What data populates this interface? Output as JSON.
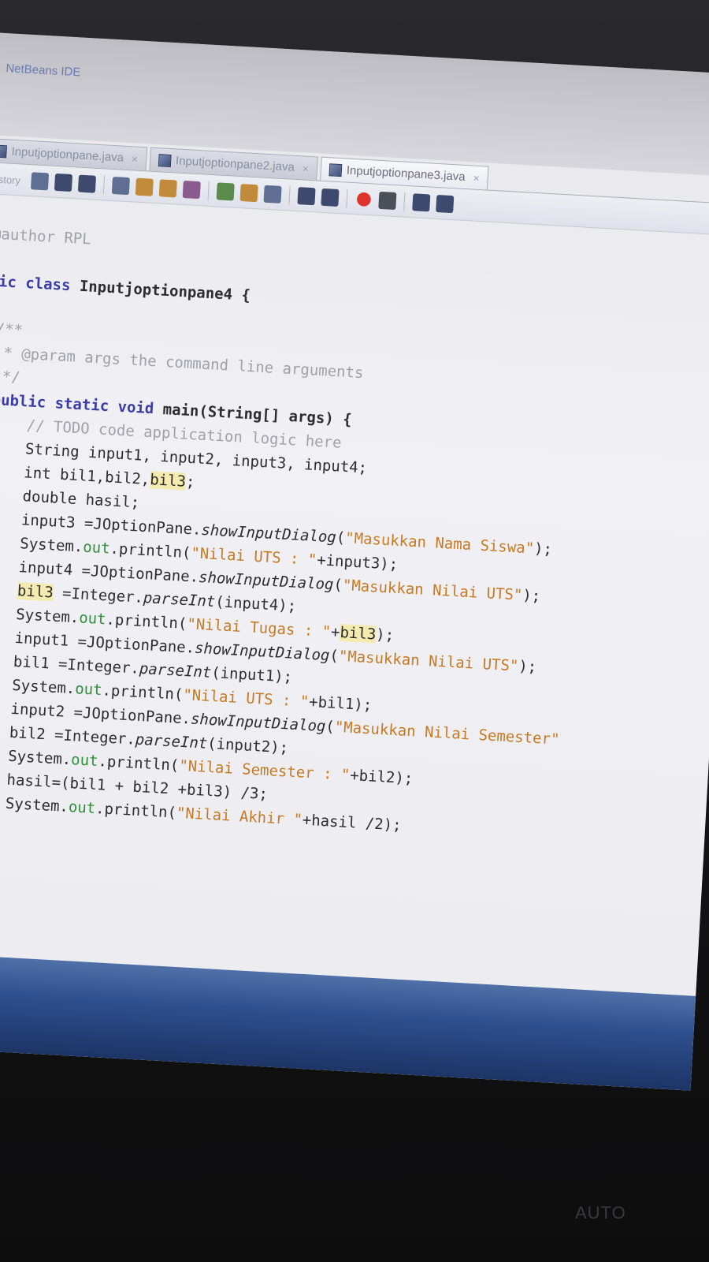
{
  "window": {
    "caption": "NetBeans IDE"
  },
  "tabs": [
    {
      "label": "Inputjoptionpane.java",
      "active": false
    },
    {
      "label": "Inputjoptionpane2.java",
      "active": false
    },
    {
      "label": "Inputjoptionpane3.java",
      "active": true
    }
  ],
  "toolbar": {
    "history_label": "History",
    "buttons": [
      "source-icon",
      "history-back-icon",
      "history-forward-icon",
      "find-icon",
      "find-prev-icon",
      "find-next-icon",
      "toggle-highlight-icon",
      "toggle-bookmark-icon",
      "prev-bookmark-icon",
      "next-bookmark-icon",
      "shift-left-icon",
      "shift-right-icon",
      "macro-record-icon",
      "macro-stop-icon",
      "comment-icon",
      "uncomment-icon"
    ]
  },
  "code": {
    "l1": " *",
    "l2": " * @author RPL",
    "l3": " */",
    "l4a": "public class ",
    "l4b": "Inputjoptionpane4 {",
    "l5": "",
    "l6": "    /**",
    "l7a": "     * @param ",
    "l7b": "args the command line arguments",
    "l8": "     */",
    "l9a": "    public static void ",
    "l9b": "main(String[] args) {",
    "l10": "        // TODO code application logic here",
    "l11": "        String input1, input2, input3, input4;",
    "l12a": "        int bil1,bil2,",
    "l12b": "bil3",
    "l12c": ";",
    "l13": "        double hasil;",
    "l14a": "        input3 =JOptionPane.",
    "l14b": "showInputDialog",
    "l14c": "(",
    "l14d": "\"Masukkan Nama Siswa\"",
    "l14e": ");",
    "l15a": "        System.",
    "l15b": "out",
    "l15c": ".println(",
    "l15d": "\"Nilai UTS : \"",
    "l15e": "+input3);",
    "l16a": "        input4 =JOptionPane.",
    "l16b": "showInputDialog",
    "l16c": "(",
    "l16d": "\"Masukkan Nilai UTS\"",
    "l16e": ");",
    "l17a": "bil3",
    "l17b": " =Integer.",
    "l17c": "parseInt",
    "l17d": "(input4);",
    "l18a": "        System.",
    "l18b": "out",
    "l18c": ".println(",
    "l18d": "\"Nilai Tugas : \"",
    "l18e": "+",
    "l18f": "bil3",
    "l18g": ");",
    "l19a": "        input1 =JOptionPane.",
    "l19b": "showInputDialog",
    "l19c": "(",
    "l19d": "\"Masukkan Nilai UTS\"",
    "l19e": ");",
    "l20a": "        bil1 =Integer.",
    "l20b": "parseInt",
    "l20c": "(input1);",
    "l21a": "        System.",
    "l21b": "out",
    "l21c": ".println(",
    "l21d": "\"Nilai UTS : \"",
    "l21e": "+bil1);",
    "l22a": "        input2 =JOptionPane.",
    "l22b": "showInputDialog",
    "l22c": "(",
    "l22d": "\"Masukkan Nilai Semester\"",
    "l23a": "        bil2 =Integer.",
    "l23b": "parseInt",
    "l23c": "(input2);",
    "l24a": "        System.",
    "l24b": "out",
    "l24c": ".println(",
    "l24d": "\"Nilai Semester : \"",
    "l24e": "+bil2);",
    "l25": "        hasil=(bil1 + bil2 +bil3) /3;",
    "l26a": "        System.",
    "l26b": "out",
    "l26c": ".println(",
    "l26d": "\"Nilai Akhir \"",
    "l26e": "+hasil /2);",
    "l27": "    }"
  },
  "bezel": {
    "label": "AUTO"
  },
  "colors": {
    "keyword": "#3a3ca8",
    "comment": "#a0a0a8",
    "string": "#c77a24",
    "highlight": "#f5ebb0",
    "taskbar": "#2e4f8d"
  }
}
